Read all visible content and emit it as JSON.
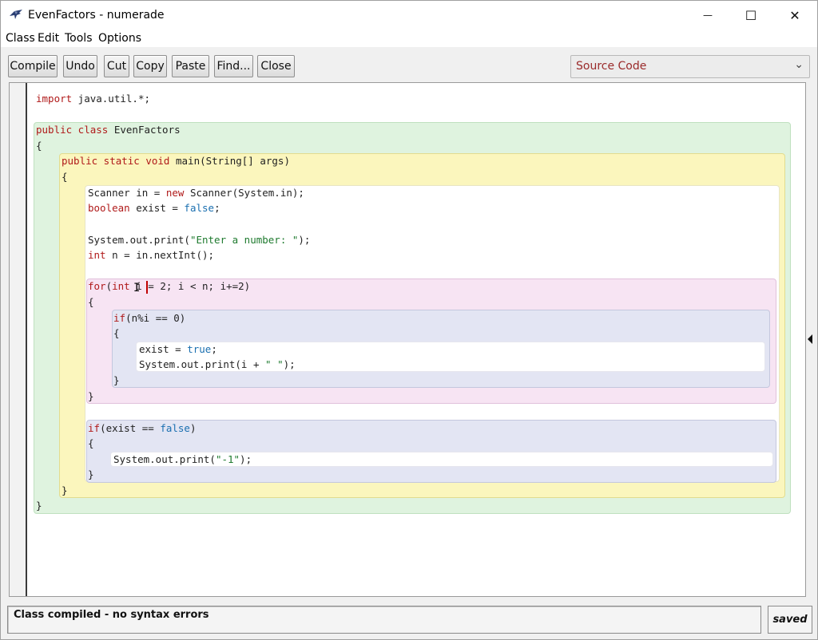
{
  "window": {
    "title": "EvenFactors - numerade",
    "minimize_glyph": "—",
    "maximize_glyph": "☐",
    "close_glyph": "✕"
  },
  "menu": [
    "Class",
    "Edit",
    "Tools",
    "Options"
  ],
  "toolbar": {
    "compile": "Compile",
    "undo": "Undo",
    "cut": "Cut",
    "copy": "Copy",
    "paste": "Paste",
    "find": "Find...",
    "close": "Close"
  },
  "view_select": {
    "selected": "Source Code",
    "arrow_glyph": "⌄"
  },
  "colors": {
    "keyword": "#b01a1a",
    "literal": "#1a6fb0",
    "string": "#1e7a2e",
    "text": "#222222",
    "class_scope": "#dff3df",
    "method_scope": "#fbf6bd",
    "loop_scope": "#f7e4f3",
    "if_scope": "#e3e5f3"
  },
  "code_lines": [
    [
      [
        "kw",
        "import"
      ],
      [
        "t",
        " java.util.*;"
      ]
    ],
    [
      [
        "kw",
        "public class"
      ],
      [
        "t",
        " EvenFactors"
      ]
    ],
    [
      [
        "t",
        "{"
      ]
    ],
    [
      [
        "kw",
        "public static void"
      ],
      [
        "t",
        " main(String[] args)"
      ]
    ],
    [
      [
        "t",
        "{"
      ]
    ],
    [
      [
        "t",
        "Scanner in = "
      ],
      [
        "kw",
        "new"
      ],
      [
        "t",
        " Scanner(System.in);"
      ]
    ],
    [
      [
        "kw",
        "boolean"
      ],
      [
        "t",
        " exist = "
      ],
      [
        "lit",
        "false"
      ],
      [
        "t",
        ";"
      ]
    ],
    [
      [
        "t",
        "System.out.print("
      ],
      [
        "str",
        "\"Enter a number: \""
      ],
      [
        "t",
        ");"
      ]
    ],
    [
      [
        "kw",
        "int"
      ],
      [
        "t",
        " n = in.nextInt();"
      ]
    ],
    [
      [
        "kw",
        "for"
      ],
      [
        "t",
        "("
      ],
      [
        "kw",
        "int"
      ],
      [
        "t",
        " i = 2; i < n; i+=2)"
      ]
    ],
    [
      [
        "t",
        "{"
      ]
    ],
    [
      [
        "kw",
        "if"
      ],
      [
        "t",
        "(n%i == 0)"
      ]
    ],
    [
      [
        "t",
        "{"
      ]
    ],
    [
      [
        "t",
        "exist = "
      ],
      [
        "lit",
        "true"
      ],
      [
        "t",
        ";"
      ]
    ],
    [
      [
        "t",
        "System.out.print(i + "
      ],
      [
        "str",
        "\" \""
      ],
      [
        "t",
        ");"
      ]
    ],
    [
      [
        "t",
        "}"
      ]
    ],
    [
      [
        "t",
        "}"
      ]
    ],
    [
      [
        "kw",
        "if"
      ],
      [
        "t",
        "(exist == "
      ],
      [
        "lit",
        "false"
      ],
      [
        "t",
        ")"
      ]
    ],
    [
      [
        "t",
        "{"
      ]
    ],
    [
      [
        "t",
        "System.out.print("
      ],
      [
        "str",
        "\"-1\""
      ],
      [
        "t",
        ");"
      ]
    ],
    [
      [
        "t",
        "}"
      ]
    ],
    [
      [
        "t",
        "}"
      ]
    ],
    [
      [
        "t",
        "}"
      ]
    ]
  ],
  "status": {
    "message": "Class compiled - no syntax errors",
    "saved": "saved"
  }
}
